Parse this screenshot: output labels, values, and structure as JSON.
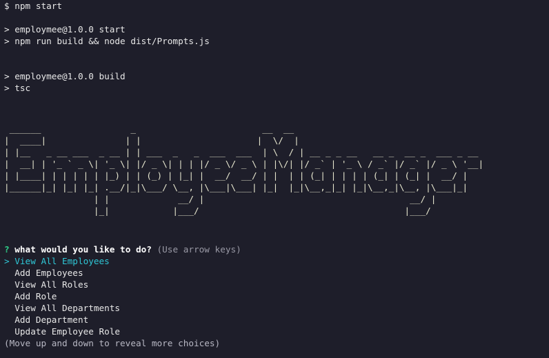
{
  "terminal": {
    "command_prompt": "$",
    "command": "npm start",
    "output_lines": [
      "> employmee@1.0.0 start",
      "> npm run build && node dist/Prompts.js",
      "",
      "",
      "> employmee@1.0.0 build",
      "> tsc"
    ],
    "banner_text": "Employee Manager",
    "banner": [
      " ______                 _                        __  __",
      "|  ____|               | |                      |  \\/  |",
      "| |__   _ __ ___  _ __ | | ___  _   _  ___  ___  | \\  / | __ _ _ __   __ _  __ _  ___ _ __",
      "|  __| | '_ ` _ \\| '_ \\| |/ _ \\| | | |/ _ \\/ _ \\ | |\\/| |/ _` | '_ \\ / _` |/ _` |/ _ \\ '__|",
      "| |____| | | | | | |_) | | (_) | |_| |  __/  __/ | |  | | (_| | | | | (_| | (_| |  __/ |",
      "|______|_| |_| |_| .__/|_|\\___/ \\__, |\\___|\\___| |_|  |_|\\__,_|_| |_|\\__,_|\\__, |\\___|_|",
      "                 | |             __/ |                                       __/ |",
      "                 |_|            |___/                                       |___/"
    ],
    "question_mark": "?",
    "question": "what would you like to do?",
    "question_hint": "(Use arrow keys)",
    "pointer": ">",
    "choices": [
      "View All Employees",
      "Add Employees",
      "View All Roles",
      "Add Role",
      "View All Departments",
      "Add Department",
      "Update Employee Role"
    ],
    "footer_hint": "(Move up and down to reveal more choices)"
  },
  "colors": {
    "background": "#1e1e2a",
    "text": "#e8e8e8",
    "question_mark": "#2fd08a",
    "selected": "#2fc7d6",
    "hint": "#9a9aa6"
  }
}
